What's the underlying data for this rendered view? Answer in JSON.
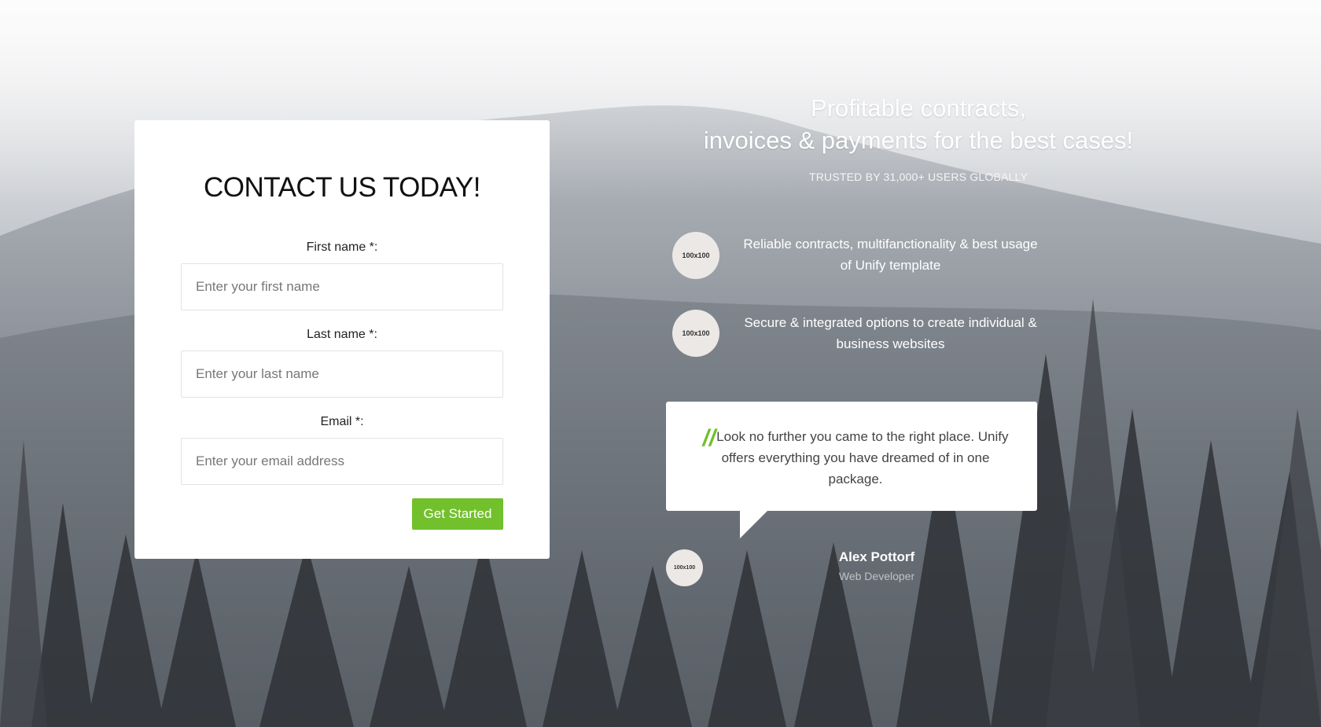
{
  "contact_form": {
    "title": "CONTACT US TODAY!",
    "first_name": {
      "label": "First name *:",
      "placeholder": "Enter your first name",
      "value": ""
    },
    "last_name": {
      "label": "Last name *:",
      "placeholder": "Enter your last name",
      "value": ""
    },
    "email": {
      "label": "Email *:",
      "placeholder": "Enter your email address",
      "value": ""
    },
    "submit_label": "Get Started"
  },
  "hero": {
    "title_line1": "Profitable contracts,",
    "title_line2": "invoices & payments for the best cases!",
    "subtitle": "TRUSTED BY 31,000+ USERS GLOBALLY"
  },
  "features": [
    {
      "avatar_text": "100x100",
      "text": "Reliable contracts, multifanctionality & best usage of Unify template"
    },
    {
      "avatar_text": "100x100",
      "text": "Secure & integrated options to create individual & business websites"
    }
  ],
  "testimonial": {
    "quote_mark": "//",
    "text": "Look no further you came to the right place. Unify offers everything you have dreamed of in one package.",
    "author_avatar_text": "100x100",
    "author_name": "Alex Pottorf",
    "author_role": "Web Developer"
  },
  "colors": {
    "accent": "#72c02c",
    "card": "#ffffff"
  }
}
